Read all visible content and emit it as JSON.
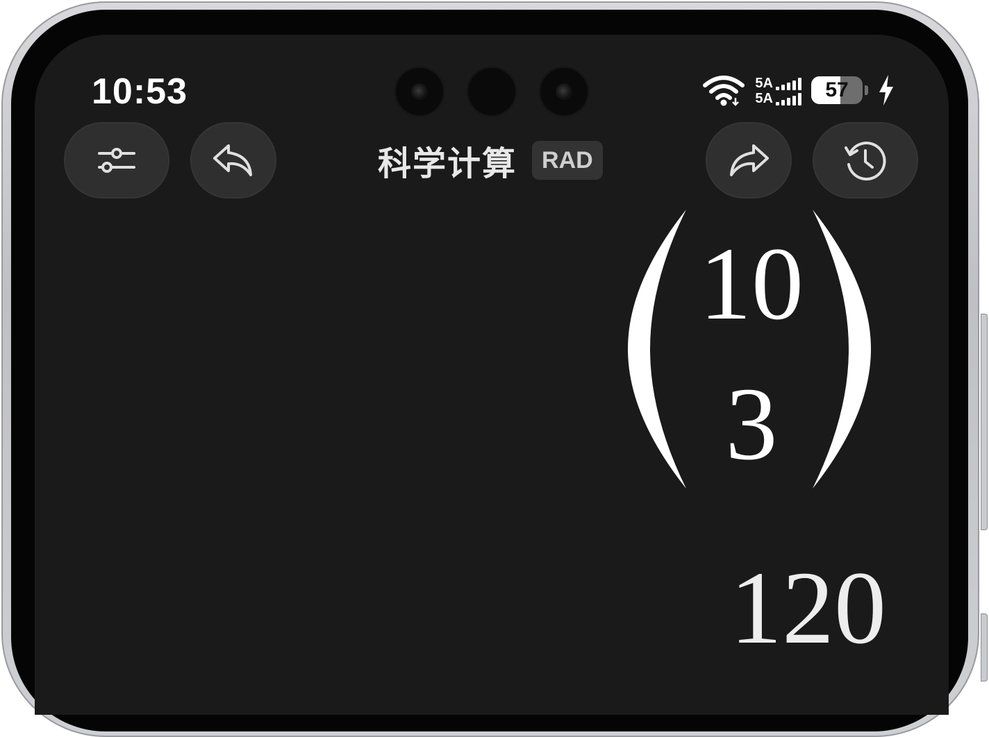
{
  "status_bar": {
    "time": "10:53",
    "network": [
      {
        "label": "5A",
        "bars": 5
      },
      {
        "label": "5A",
        "bars": 5
      }
    ],
    "battery": {
      "level": 57,
      "label": "57",
      "charging": true
    },
    "icons": [
      "wifi-icon",
      "charging-bolt-icon"
    ]
  },
  "toolbar": {
    "left_buttons": [
      "sliders-icon",
      "undo-icon"
    ],
    "title": "科学计算",
    "mode": "RAD",
    "right_buttons": [
      "redo-icon",
      "history-icon"
    ]
  },
  "display": {
    "expression": {
      "type": "binomial",
      "top": "10",
      "bottom": "3"
    },
    "result": "120"
  },
  "colors": {
    "background": "#1a1a1a",
    "button": "#2f2f2f",
    "text": "#ffffff"
  }
}
